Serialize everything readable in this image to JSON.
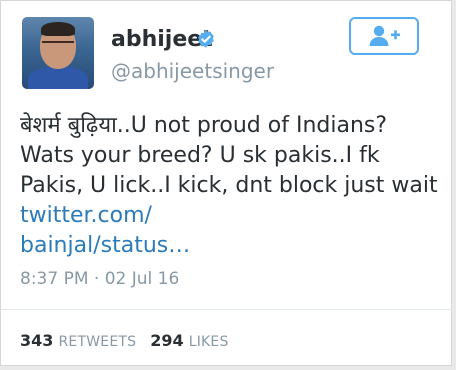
{
  "profile": {
    "display_name": "abhijeet",
    "handle": "@abhijeetsinger",
    "verified_icon": "verified-badge-icon"
  },
  "follow_button": {
    "icon": "person-add-icon"
  },
  "tweet": {
    "text": "बेशर्म बुढ़िया..U not proud of Indians? Wats your breed? U sk pakis..I fk Pakis, U lick..I kick, dnt block just wait ",
    "link": "twitter.com/\nbainjal/status…",
    "timestamp": "8:37 PM · 02 Jul 16"
  },
  "stats": {
    "retweets_count": "343",
    "retweets_label": "RETWEETS",
    "likes_count": "294",
    "likes_label": "LIKES"
  },
  "colors": {
    "accent": "#55acee",
    "link": "#2b7bb9",
    "muted": "#8899a6",
    "text": "#292f33"
  }
}
